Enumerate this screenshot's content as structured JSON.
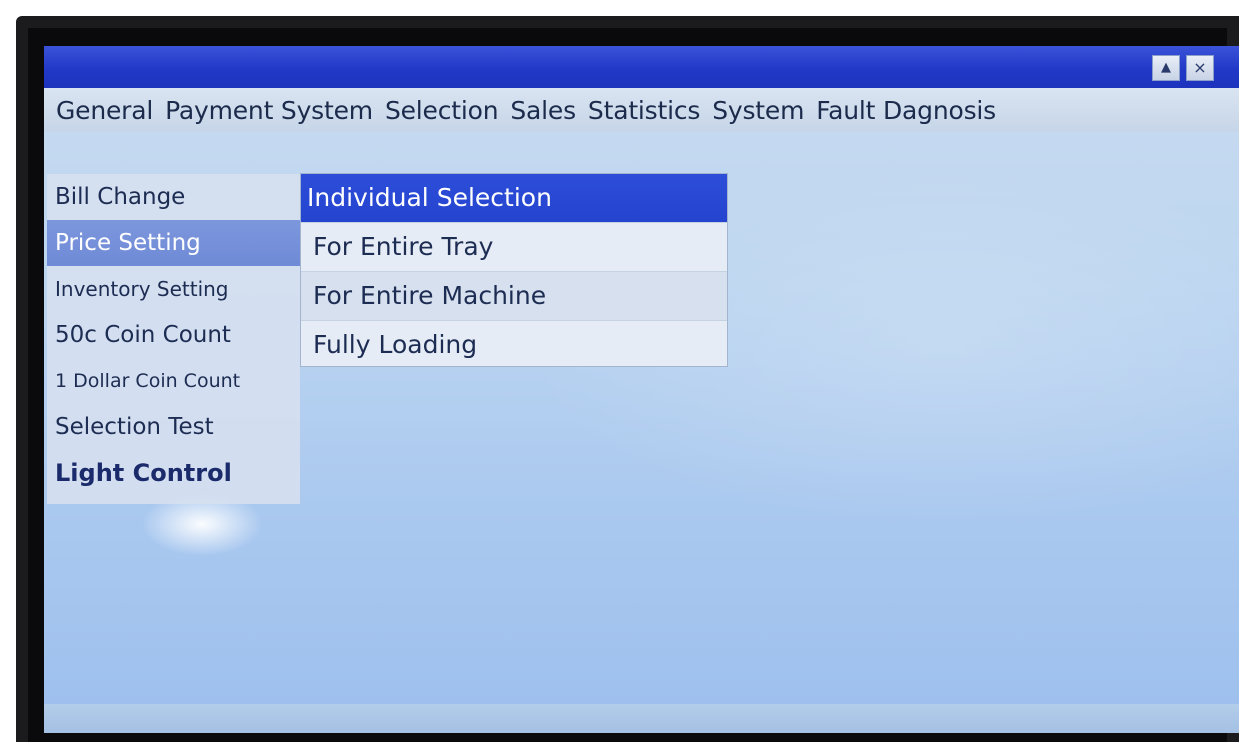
{
  "window": {
    "buttons": {
      "up_symbol": "▲",
      "close_symbol": "×"
    }
  },
  "menubar": {
    "items": [
      "General",
      "Payment System",
      "Selection",
      "Sales",
      "Statistics",
      "System",
      "Fault Dagnosis"
    ]
  },
  "left_menu": {
    "items": [
      "Bill Change",
      "Price Setting",
      "Inventory Setting",
      "50c Coin Count",
      "1 Dollar Coin Count",
      "Selection Test",
      "Light Control"
    ],
    "active": "Price Setting"
  },
  "submenu": {
    "items": [
      "Individual Selection",
      "For Entire Tray",
      "For Entire Machine",
      "Fully Loading"
    ],
    "selected": "Individual Selection"
  },
  "colors": {
    "titlebar": "#2239c8",
    "selection": "#2d4ed9",
    "active_left": "#7d97dd",
    "background": "#bcd5f0"
  }
}
